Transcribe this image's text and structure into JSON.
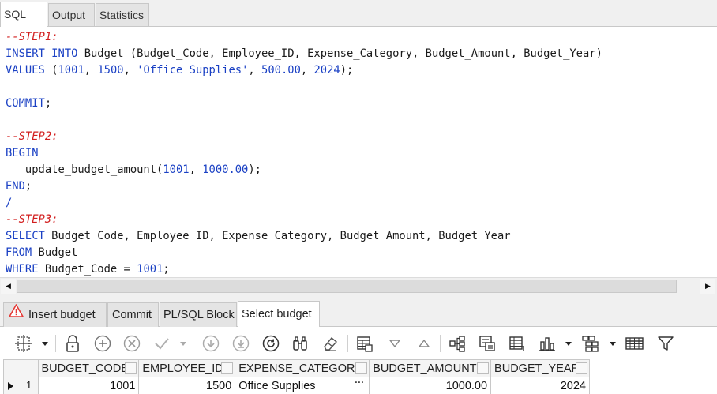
{
  "top_tabs": [
    {
      "label": "SQL",
      "active": true
    },
    {
      "label": "Output",
      "active": false
    },
    {
      "label": "Statistics",
      "active": false
    }
  ],
  "editor": {
    "lines": [
      [
        {
          "t": "--STEP1:",
          "c": "cm"
        }
      ],
      [
        {
          "t": "INSERT",
          "c": "kw"
        },
        {
          "t": " "
        },
        {
          "t": "INTO",
          "c": "kw"
        },
        {
          "t": " Budget (Budget_Code, Employee_ID, Expense_Category, Budget_Amount, Budget_Year)"
        }
      ],
      [
        {
          "t": "VALUES",
          "c": "kw"
        },
        {
          "t": " ("
        },
        {
          "t": "1001",
          "c": "nm"
        },
        {
          "t": ", "
        },
        {
          "t": "1500",
          "c": "nm"
        },
        {
          "t": ", "
        },
        {
          "t": "'Office Supplies'",
          "c": "st"
        },
        {
          "t": ", "
        },
        {
          "t": "500.00",
          "c": "nm"
        },
        {
          "t": ", "
        },
        {
          "t": "2024",
          "c": "nm"
        },
        {
          "t": ");"
        }
      ],
      [],
      [
        {
          "t": "COMMIT",
          "c": "kw"
        },
        {
          "t": ";"
        }
      ],
      [],
      [
        {
          "t": "--STEP2:",
          "c": "cm"
        }
      ],
      [
        {
          "t": "BEGIN",
          "c": "kw"
        }
      ],
      [
        {
          "t": "   update_budget_amount("
        },
        {
          "t": "1001",
          "c": "nm"
        },
        {
          "t": ", "
        },
        {
          "t": "1000.00",
          "c": "nm"
        },
        {
          "t": ");"
        }
      ],
      [
        {
          "t": "END",
          "c": "kw"
        },
        {
          "t": ";"
        }
      ],
      [
        {
          "t": "/",
          "c": "kw"
        }
      ],
      [
        {
          "t": "--STEP3:",
          "c": "cm"
        }
      ],
      [
        {
          "t": "SELECT",
          "c": "kw"
        },
        {
          "t": " Budget_Code, Employee_ID, Expense_Category, Budget_Amount, Budget_Year"
        }
      ],
      [
        {
          "t": "FROM",
          "c": "kw"
        },
        {
          "t": " Budget"
        }
      ],
      [
        {
          "t": "WHERE",
          "c": "kw"
        },
        {
          "t": " Budget_Code = "
        },
        {
          "t": "1001",
          "c": "nm"
        },
        {
          "t": ";"
        }
      ]
    ]
  },
  "result_tabs": [
    {
      "label": "Insert budget",
      "icon": "warning-icon",
      "active": false
    },
    {
      "label": "Commit",
      "active": false
    },
    {
      "label": "PL/SQL Block",
      "active": false
    },
    {
      "label": "Select budget",
      "active": true
    }
  ],
  "toolbar_icons": [
    "grid-select-icon",
    "lock-icon",
    "add-record-icon",
    "delete-record-icon",
    "post-changes-icon",
    "first-record-icon",
    "last-record-icon",
    "refresh-icon",
    "find-icon",
    "clear-icon",
    "export-icon",
    "sort-descending-icon",
    "sort-ascending-icon",
    "tree-icon",
    "record-view-icon",
    "pivot-icon",
    "chart-icon",
    "group-icon",
    "table-view-icon",
    "filter-icon"
  ],
  "grid": {
    "columns": [
      "BUDGET_CODE",
      "EMPLOYEE_ID",
      "EXPENSE_CATEGORY",
      "BUDGET_AMOUNT",
      "BUDGET_YEAR"
    ],
    "rows": [
      {
        "num": "1",
        "cells": [
          "1001",
          "1500",
          "Office Supplies",
          "1000.00",
          "2024"
        ]
      }
    ]
  },
  "colors": {
    "keyword": "#1a40c4",
    "comment": "#d21e1e",
    "warning": "#e53935"
  }
}
